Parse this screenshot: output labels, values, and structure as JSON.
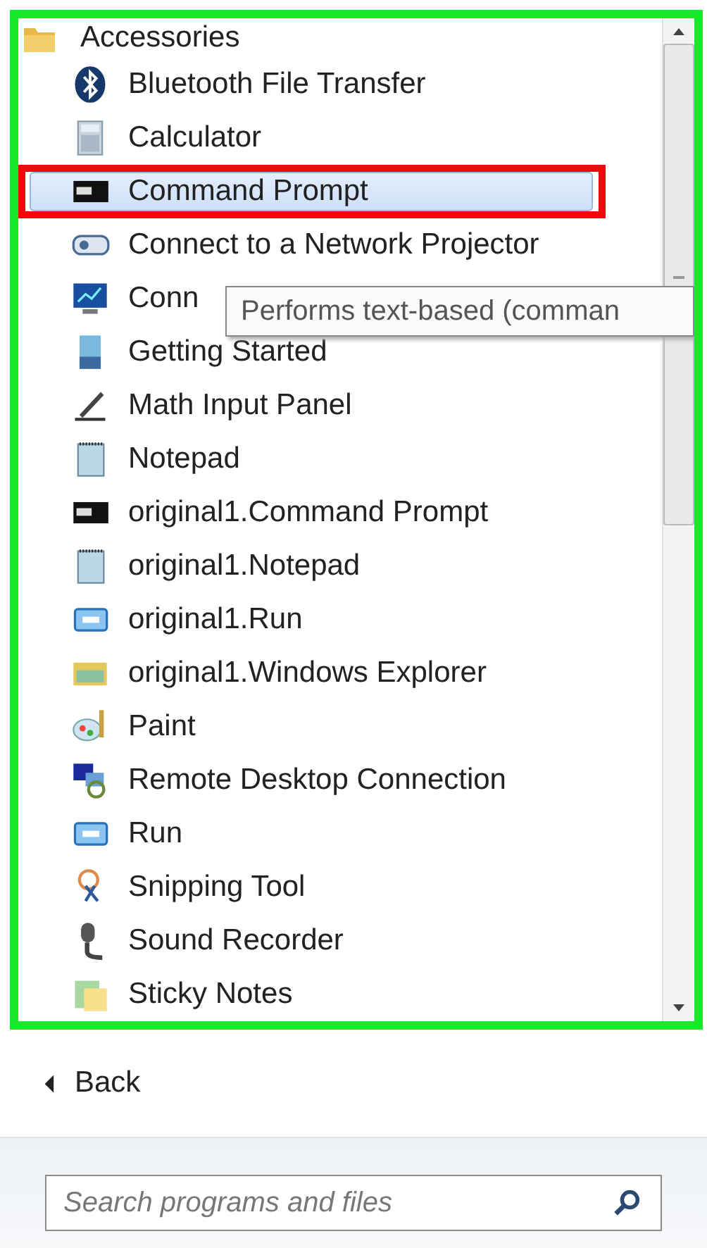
{
  "programs": {
    "folder": "Accessories",
    "items": [
      {
        "label": "Bluetooth File Transfer",
        "selected": false
      },
      {
        "label": "Calculator",
        "selected": false
      },
      {
        "label": "Command Prompt",
        "selected": true,
        "color": "#ee0a0a"
      },
      {
        "label": "Connect to a Network Projector",
        "selected": false
      },
      {
        "label": "Conn",
        "selected": false
      },
      {
        "label": "Getting Started",
        "selected": false
      },
      {
        "label": "Math Input Panel",
        "selected": false
      },
      {
        "label": "Notepad",
        "selected": false
      },
      {
        "label": "original1.Command Prompt",
        "selected": false
      },
      {
        "label": "original1.Notepad",
        "selected": false
      },
      {
        "label": "original1.Run",
        "selected": false
      },
      {
        "label": "original1.Windows Explorer",
        "selected": false
      },
      {
        "label": "Paint",
        "selected": false
      },
      {
        "label": "Remote Desktop Connection",
        "selected": false
      },
      {
        "label": "Run",
        "selected": false
      },
      {
        "label": "Snipping Tool",
        "selected": false
      },
      {
        "label": "Sound Recorder",
        "selected": false
      },
      {
        "label": "Sticky Notes",
        "selected": false
      }
    ],
    "tooltip": "Performs text-based (comman",
    "color": "#18e828"
  },
  "back": {
    "label": "Back"
  },
  "search": {
    "placeholder": "Search programs and files"
  }
}
